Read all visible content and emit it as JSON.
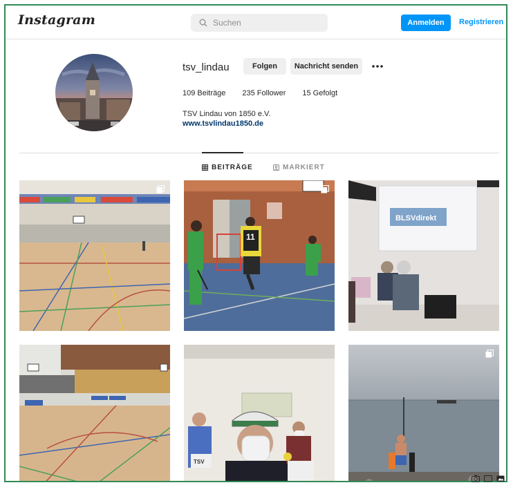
{
  "header": {
    "logo": "Instagram",
    "search_placeholder": "Suchen",
    "login_label": "Anmelden",
    "register_label": "Registrieren"
  },
  "profile": {
    "username": "tsv_lindau",
    "follow_label": "Folgen",
    "message_label": "Nachricht senden",
    "more_icon": "more-horizontal-icon",
    "stats": {
      "posts": "109 Beiträge",
      "followers": "235 Follower",
      "following": "15 Gefolgt"
    },
    "bio_name": "TSV Lindau von 1850 e.V.",
    "website": "www.tsvlindau1850.de"
  },
  "tabs": [
    {
      "label": "BEITRÄGE",
      "icon": "grid-icon",
      "active": true
    },
    {
      "label": "MARKIERT",
      "icon": "tagged-icon",
      "active": false
    }
  ],
  "posts": [
    {
      "subject": "sports-hall-empty",
      "multi": true
    },
    {
      "subject": "floorball-players",
      "multi": true
    },
    {
      "subject": "presentation-room",
      "multi": false
    },
    {
      "subject": "sports-hall-wide",
      "multi": false
    },
    {
      "subject": "people-with-masks",
      "multi": false
    },
    {
      "subject": "lake-swimmer",
      "multi": true
    }
  ],
  "presentation_text": "BLSVdirekt",
  "shirt_number": "11",
  "sign_text": "TSV",
  "colors": {
    "accent": "#0095f6",
    "frame": "#2f8a55",
    "link": "#00376b"
  }
}
